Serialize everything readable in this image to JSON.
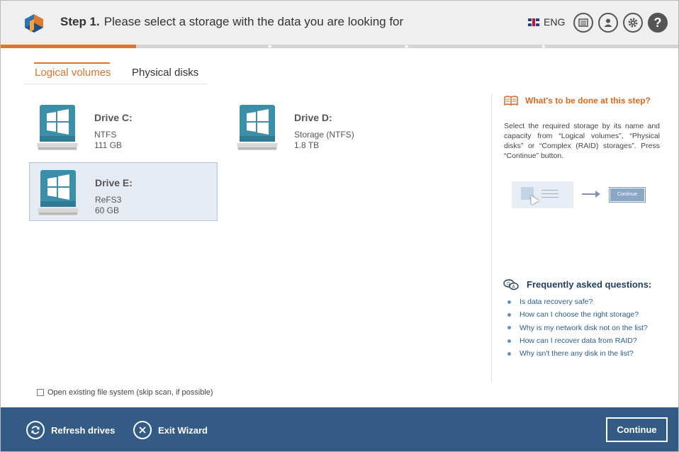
{
  "header": {
    "step_label": "Step 1.",
    "title": "Please select a storage with the data you are looking for",
    "language": "ENG",
    "icons": [
      "app-logo-icon",
      "flag-uk-icon",
      "keyboard-icon",
      "user-icon",
      "gear-icon",
      "help-icon"
    ],
    "help_glyph": "?"
  },
  "progress": {
    "fraction": 0.2,
    "step_count": 5
  },
  "tabs": [
    {
      "label": "Logical volumes",
      "active": true
    },
    {
      "label": "Physical disks",
      "active": false
    }
  ],
  "drives": [
    {
      "name": "Drive C:",
      "fs": "NTFS",
      "size": "111 GB",
      "selected": false
    },
    {
      "name": "Drive D:",
      "fs": "Storage (NTFS)",
      "size": "1.8 TB",
      "selected": false
    },
    {
      "name": "Drive E:",
      "fs": "ReFS3",
      "size": "60 GB",
      "selected": true
    }
  ],
  "options": {
    "open_fs_label": "Open existing file system (skip scan, if possible)",
    "open_fs_checked": false
  },
  "help": {
    "title": "What's to be done at this step?",
    "text": "Select the required storage by its name and capacity from “Logical volumes”, “Physical disks” or “Complex (RAID) storages”. Press “Continue” button.",
    "illustration_button": "Continue"
  },
  "faq": {
    "title": "Frequently asked questions:",
    "items": [
      "Is data recovery safe?",
      "How can I choose the right storage?",
      "Why is my network disk not on the list?",
      "How can I recover data from RAID?",
      "Why isn't there any disk in the list?"
    ]
  },
  "footer": {
    "refresh_label": "Refresh drives",
    "exit_label": "Exit Wizard",
    "continue_label": "Continue"
  },
  "colors": {
    "accent": "#e0742f",
    "footer": "#335b85",
    "selection": "#e6ebf3"
  }
}
